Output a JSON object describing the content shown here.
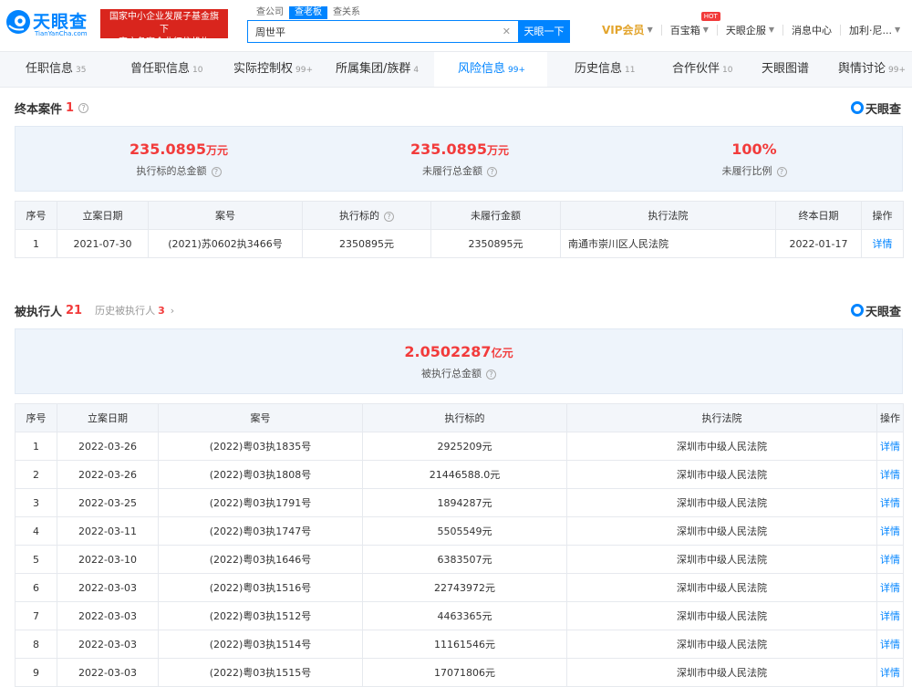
{
  "header": {
    "logo_text": "天眼查",
    "logo_sub": "TianYanCha.com",
    "gov_badge_line1": "国家中小企业发展子基金旗下",
    "gov_badge_line2": "官方备案企业征信机构",
    "search_tabs": [
      "查公司",
      "查老板",
      "查关系"
    ],
    "search_value": "周世平",
    "search_button": "天眼一下",
    "nav": {
      "vip": "VIP会员",
      "baibao": "百宝箱",
      "hot": "HOT",
      "qiyeban": "天眼企服",
      "messages": "消息中心",
      "user": "加利·尼..."
    }
  },
  "tabs": [
    {
      "label": "任职信息",
      "count": "35"
    },
    {
      "label": "曾任职信息",
      "count": "10"
    },
    {
      "label": "实际控制权",
      "count": "99+"
    },
    {
      "label": "所属集团/族群",
      "count": "4"
    },
    {
      "label": "风险信息",
      "count": "99+"
    },
    {
      "label": "历史信息",
      "count": "11"
    },
    {
      "label": "合作伙伴",
      "count": "10"
    },
    {
      "label": "天眼图谱",
      "count": ""
    },
    {
      "label": "舆情讨论",
      "count": "99+"
    }
  ],
  "brand": "天眼查",
  "final_cases": {
    "title": "终本案件",
    "count": "1",
    "stats": [
      {
        "value": "235.0895",
        "unit": "万元",
        "label": "执行标的总金额"
      },
      {
        "value": "235.0895",
        "unit": "万元",
        "label": "未履行总金额"
      },
      {
        "value": "100%",
        "unit": "",
        "label": "未履行比例"
      }
    ],
    "columns": [
      "序号",
      "立案日期",
      "案号",
      "执行标的",
      "未履行金额",
      "执行法院",
      "终本日期",
      "操作"
    ],
    "rows": [
      [
        "1",
        "2021-07-30",
        "(2021)苏0602执3466号",
        "2350895元",
        "2350895元",
        "南通市崇川区人民法院",
        "2022-01-17",
        "详情"
      ]
    ]
  },
  "executed": {
    "title": "被执行人",
    "count": "21",
    "history_label": "历史被执行人",
    "history_count": "3",
    "total_value": "2.0502287",
    "total_unit": "亿元",
    "total_label": "被执行总金额",
    "columns": [
      "序号",
      "立案日期",
      "案号",
      "执行标的",
      "执行法院",
      "操作"
    ],
    "rows": [
      [
        "1",
        "2022-03-26",
        "(2022)粤03执1835号",
        "2925209元",
        "深圳市中级人民法院",
        "详情"
      ],
      [
        "2",
        "2022-03-26",
        "(2022)粤03执1808号",
        "21446588.0元",
        "深圳市中级人民法院",
        "详情"
      ],
      [
        "3",
        "2022-03-25",
        "(2022)粤03执1791号",
        "1894287元",
        "深圳市中级人民法院",
        "详情"
      ],
      [
        "4",
        "2022-03-11",
        "(2022)粤03执1747号",
        "5505549元",
        "深圳市中级人民法院",
        "详情"
      ],
      [
        "5",
        "2022-03-10",
        "(2022)粤03执1646号",
        "6383507元",
        "深圳市中级人民法院",
        "详情"
      ],
      [
        "6",
        "2022-03-03",
        "(2022)粤03执1516号",
        "22743972元",
        "深圳市中级人民法院",
        "详情"
      ],
      [
        "7",
        "2022-03-03",
        "(2022)粤03执1512号",
        "4463365元",
        "深圳市中级人民法院",
        "详情"
      ],
      [
        "8",
        "2022-03-03",
        "(2022)粤03执1514号",
        "11161546元",
        "深圳市中级人民法院",
        "详情"
      ],
      [
        "9",
        "2022-03-03",
        "(2022)粤03执1515号",
        "17071806元",
        "深圳市中级人民法院",
        "详情"
      ]
    ]
  },
  "colors": {
    "accent": "#0084ff",
    "danger": "#f23b3b",
    "vip": "#e3a52e",
    "badge": "#d9251d"
  }
}
